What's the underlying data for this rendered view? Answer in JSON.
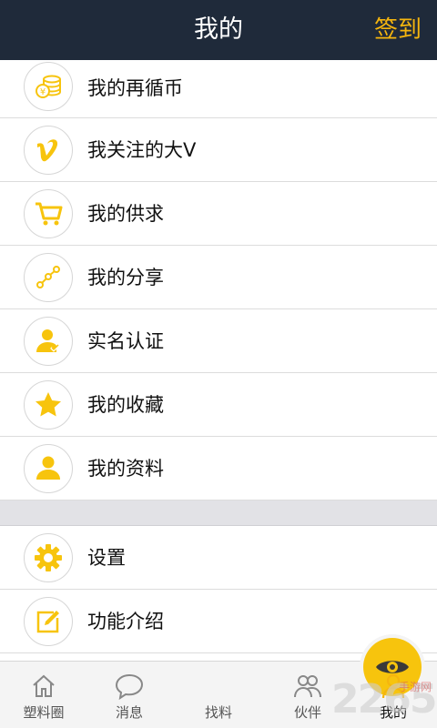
{
  "header": {
    "title": "我的",
    "checkin_label": "签到"
  },
  "menu": {
    "items": [
      {
        "label": "我的再循币",
        "icon": "coin-stack-icon"
      },
      {
        "label": "我关注的大V",
        "icon": "v-icon"
      },
      {
        "label": "我的供求",
        "icon": "shopping-cart-icon"
      },
      {
        "label": "我的分享",
        "icon": "share-icon"
      },
      {
        "label": "实名认证",
        "icon": "verified-user-icon"
      },
      {
        "label": "我的收藏",
        "icon": "star-icon"
      },
      {
        "label": "我的资料",
        "icon": "user-profile-icon"
      }
    ],
    "settings_items": [
      {
        "label": "设置",
        "icon": "gear-icon"
      },
      {
        "label": "功能介绍",
        "icon": "edit-icon"
      }
    ]
  },
  "tabbar": {
    "tabs": [
      {
        "label": "塑料圈",
        "icon": "home-icon"
      },
      {
        "label": "消息",
        "icon": "chat-bubble-icon"
      },
      {
        "label": "找料",
        "icon": "eye-icon"
      },
      {
        "label": "伙伴",
        "icon": "partners-icon"
      },
      {
        "label": "我的",
        "icon": "person-icon"
      }
    ],
    "active": "我的"
  },
  "watermark": {
    "number": "2265",
    "site": "手游网"
  },
  "colors": {
    "header_bg": "#1f2a3a",
    "accent": "#f5b50e",
    "icon_yellow": "#f7c40d"
  }
}
